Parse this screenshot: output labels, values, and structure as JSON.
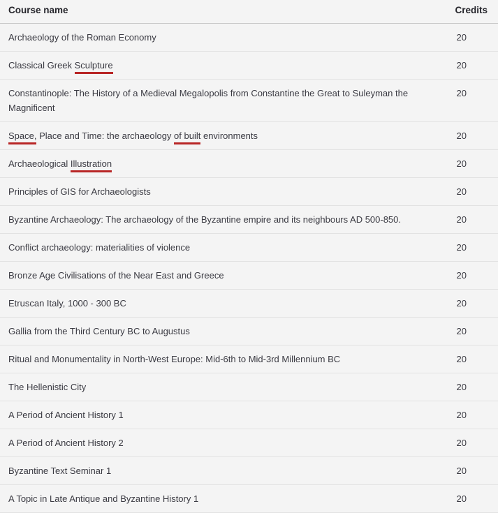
{
  "table": {
    "columns": [
      {
        "key": "name",
        "label": "Course name",
        "align": "left"
      },
      {
        "key": "credits",
        "label": "Credits",
        "align": "right"
      }
    ],
    "annotation_color": "#b82626",
    "rows": [
      {
        "name": "Archaeology of the Roman Economy",
        "credits": "20",
        "segments": [
          {
            "text": "Archaeology of the Roman Economy",
            "underline": false
          }
        ]
      },
      {
        "name": "Classical Greek Sculpture",
        "credits": "20",
        "segments": [
          {
            "text": "Classical Greek ",
            "underline": false
          },
          {
            "text": "Sculpture",
            "underline": true
          }
        ]
      },
      {
        "name": "Constantinople: The History of a Medieval Megalopolis from Constantine the Great to Suleyman the Magnificent",
        "credits": "20",
        "segments": [
          {
            "text": "Constantinople: The History of a Medieval Megalopolis from Constantine the Great to Suleyman the Magnificent",
            "underline": false
          }
        ]
      },
      {
        "name": "Space, Place and Time: the archaeology of built environments",
        "credits": "20",
        "segments": [
          {
            "text": "Space,",
            "underline": true
          },
          {
            "text": " Place and Time: the archaeology ",
            "underline": false
          },
          {
            "text": "of built",
            "underline": true
          },
          {
            "text": " environments",
            "underline": false
          }
        ]
      },
      {
        "name": "Archaeological Illustration",
        "credits": "20",
        "segments": [
          {
            "text": "Archaeological ",
            "underline": false
          },
          {
            "text": "Illustration",
            "underline": true
          }
        ]
      },
      {
        "name": "Principles of GIS for Archaeologists",
        "credits": "20",
        "segments": [
          {
            "text": "Principles of GIS for Archaeologists",
            "underline": false
          }
        ]
      },
      {
        "name": "Byzantine Archaeology: The archaeology of the Byzantine empire and its neighbours AD 500-850.",
        "credits": "20",
        "segments": [
          {
            "text": "Byzantine Archaeology: The archaeology of the Byzantine empire and its neighbours AD 500-850.",
            "underline": false
          }
        ]
      },
      {
        "name": "Conflict archaeology: materialities of violence",
        "credits": "20",
        "segments": [
          {
            "text": "Conflict archaeology: materialities of violence",
            "underline": false
          }
        ]
      },
      {
        "name": "Bronze Age Civilisations of the Near East and Greece",
        "credits": "20",
        "segments": [
          {
            "text": "Bronze Age Civilisations of the Near East and Greece",
            "underline": false
          }
        ]
      },
      {
        "name": "Etruscan Italy, 1000 - 300 BC",
        "credits": "20",
        "segments": [
          {
            "text": "Etruscan Italy, 1000 - 300 BC",
            "underline": false
          }
        ]
      },
      {
        "name": "Gallia from the Third Century BC to Augustus",
        "credits": "20",
        "segments": [
          {
            "text": "Gallia from the Third Century BC to Augustus",
            "underline": false
          }
        ]
      },
      {
        "name": "Ritual and Monumentality in North-West Europe: Mid-6th to Mid-3rd Millennium BC",
        "credits": "20",
        "segments": [
          {
            "text": "Ritual and Monumentality in North-West Europe: Mid-6th to Mid-3rd Millennium BC",
            "underline": false
          }
        ]
      },
      {
        "name": "The Hellenistic City",
        "credits": "20",
        "segments": [
          {
            "text": "The Hellenistic City",
            "underline": false
          }
        ]
      },
      {
        "name": "A Period of Ancient History 1",
        "credits": "20",
        "segments": [
          {
            "text": "A Period of Ancient History 1",
            "underline": false
          }
        ]
      },
      {
        "name": "A Period of Ancient History 2",
        "credits": "20",
        "segments": [
          {
            "text": "A Period of Ancient History 2",
            "underline": false
          }
        ]
      },
      {
        "name": "Byzantine Text Seminar 1",
        "credits": "20",
        "segments": [
          {
            "text": "Byzantine Text Seminar 1",
            "underline": false
          }
        ]
      },
      {
        "name": "A Topic in Late Antique and Byzantine History 1",
        "credits": "20",
        "segments": [
          {
            "text": "A Topic in Late Antique and Byzantine History 1",
            "underline": false
          }
        ]
      }
    ]
  }
}
